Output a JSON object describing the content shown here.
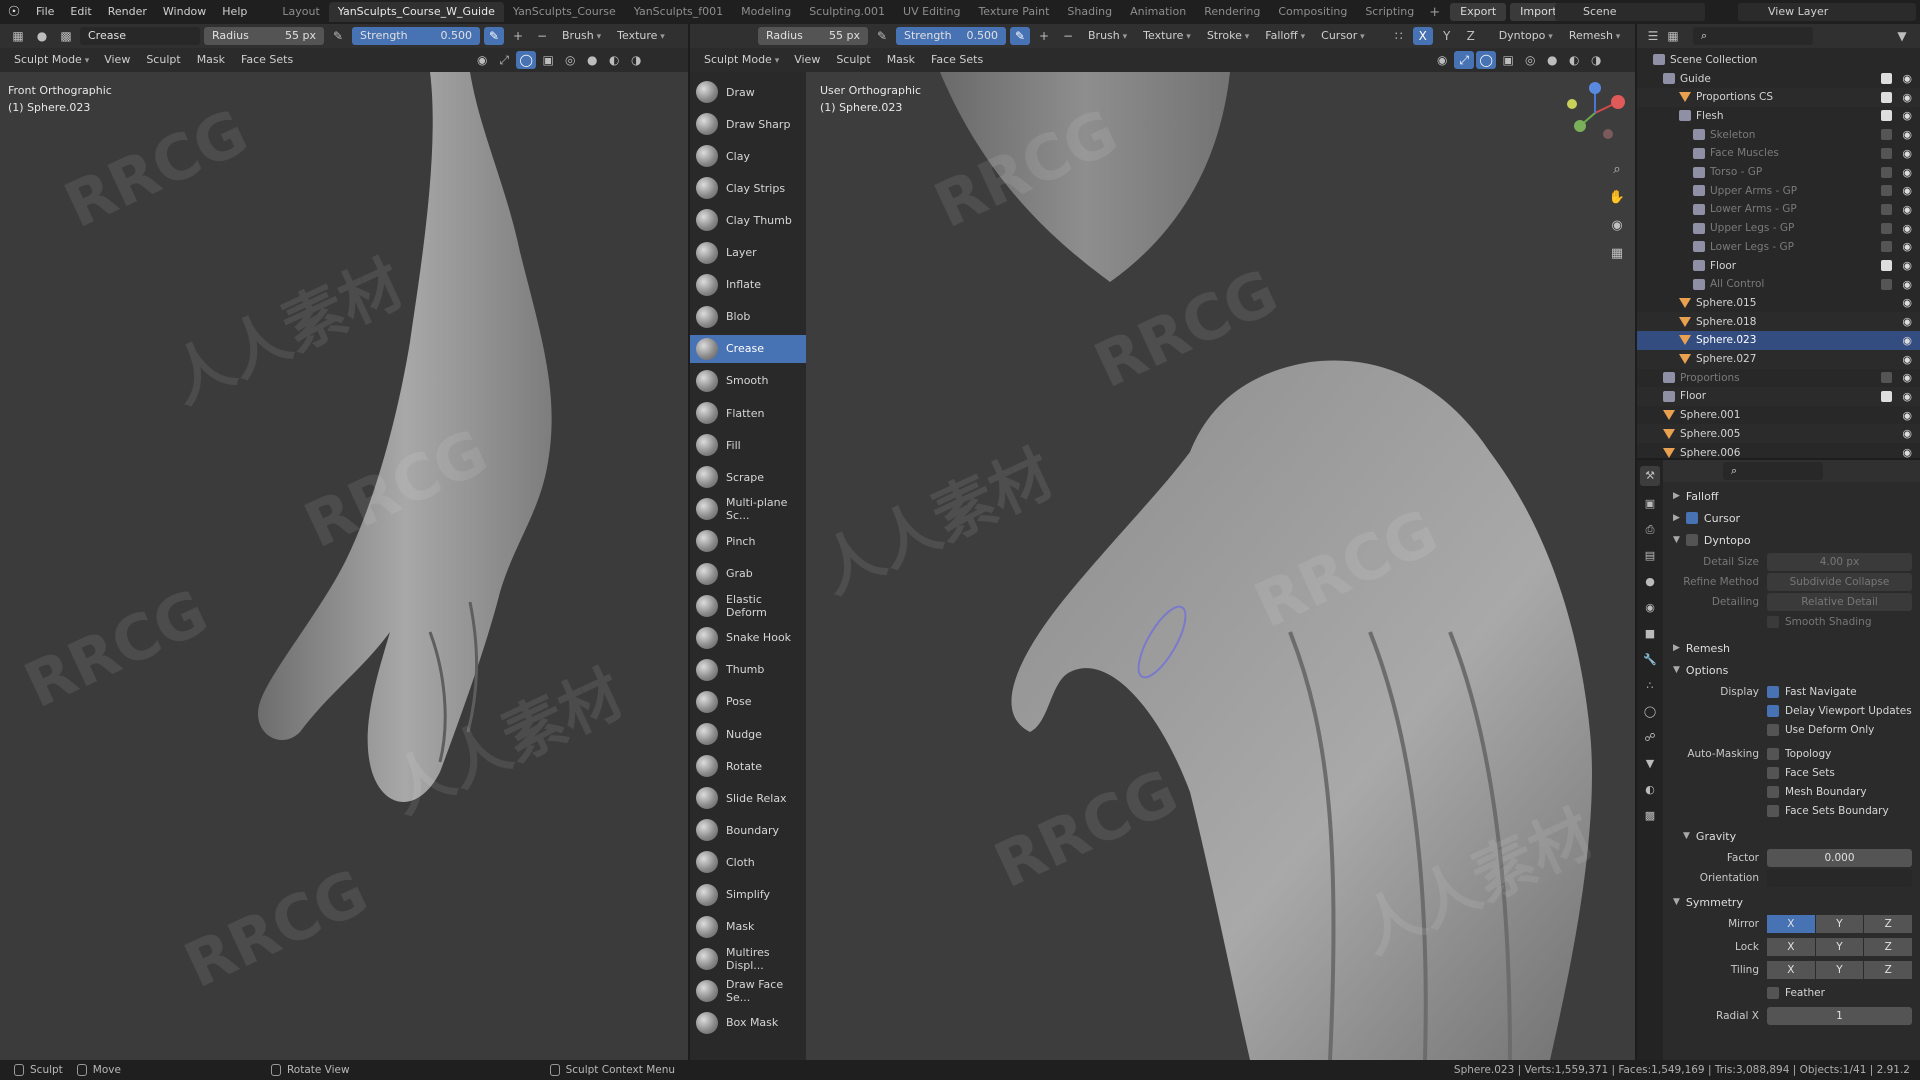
{
  "menubar": {
    "items": [
      "File",
      "Edit",
      "Render",
      "Window",
      "Help"
    ],
    "workspaces": [
      "Layout",
      "YanSculpts_Course_W_Guide",
      "YanSculpts_Course",
      "YanSculpts_f001",
      "Modeling",
      "Sculpting.001",
      "UV Editing",
      "Texture Paint",
      "Shading",
      "Animation",
      "Rendering",
      "Compositing",
      "Scripting"
    ],
    "active_workspace": "YanSculpts_Course_W_Guide",
    "export_label": "Export",
    "import_label": "Import",
    "scene": "Scene",
    "view_layer": "View Layer"
  },
  "left_tool_header": {
    "brush_name": "Crease",
    "radius_label": "Radius",
    "radius_value": "55 px",
    "strength_label": "Strength",
    "strength_value": "0.500",
    "brush_menu": "Brush",
    "texture_menu": "Texture"
  },
  "right_tool_header": {
    "radius_label": "Radius",
    "radius_value": "55 px",
    "strength_label": "Strength",
    "strength_value": "0.500",
    "brush_menu": "Brush",
    "texture_menu": "Texture",
    "stroke_menu": "Stroke",
    "falloff_menu": "Falloff",
    "cursor_menu": "Cursor",
    "dyntopo_menu": "Dyntopo",
    "remesh_menu": "Remesh",
    "axis_x": "X",
    "axis_y": "Y",
    "axis_z": "Z"
  },
  "mode_header": {
    "mode": "Sculpt Mode",
    "menus": [
      "View",
      "Sculpt",
      "Mask",
      "Face Sets"
    ]
  },
  "left_viewport": {
    "view_name": "Front Orthographic",
    "object_name": "(1) Sphere.023"
  },
  "right_viewport": {
    "view_name": "User Orthographic",
    "object_name": "(1) Sphere.023"
  },
  "watermark_text": [
    "RRCG",
    "人人素材"
  ],
  "tools": [
    "Draw",
    "Draw Sharp",
    "Clay",
    "Clay Strips",
    "Clay Thumb",
    "Layer",
    "Inflate",
    "Blob",
    "Crease",
    "Smooth",
    "Flatten",
    "Fill",
    "Scrape",
    "Multi-plane Sc...",
    "Pinch",
    "Grab",
    "Elastic Deform",
    "Snake Hook",
    "Thumb",
    "Pose",
    "Nudge",
    "Rotate",
    "Slide Relax",
    "Boundary",
    "Cloth",
    "Simplify",
    "Mask",
    "Multires Displ...",
    "Draw Face Se...",
    "Box Mask"
  ],
  "active_tool": "Crease",
  "outliner": {
    "root": "Scene Collection",
    "rows": [
      {
        "name": "Guide",
        "type": "collection",
        "dim": false,
        "selected": false,
        "check": true
      },
      {
        "name": "Proportions CS",
        "type": "object",
        "dim": false,
        "selected": false,
        "check": true
      },
      {
        "name": "Flesh",
        "type": "collection",
        "dim": false,
        "selected": false,
        "check": true
      },
      {
        "name": "Skeleton",
        "type": "collection",
        "dim": true,
        "selected": false,
        "check": false
      },
      {
        "name": "Face Muscles",
        "type": "collection",
        "dim": true,
        "selected": false,
        "check": false
      },
      {
        "name": "Torso - GP",
        "type": "collection",
        "dim": true,
        "selected": false,
        "check": false
      },
      {
        "name": "Upper Arms - GP",
        "type": "collection",
        "dim": true,
        "selected": false,
        "check": false
      },
      {
        "name": "Lower Arms - GP",
        "type": "collection",
        "dim": true,
        "selected": false,
        "check": false
      },
      {
        "name": "Upper Legs - GP",
        "type": "collection",
        "dim": true,
        "selected": false,
        "check": false
      },
      {
        "name": "Lower Legs - GP",
        "type": "collection",
        "dim": true,
        "selected": false,
        "check": false
      },
      {
        "name": "Floor",
        "type": "collection",
        "dim": false,
        "selected": false,
        "check": true
      },
      {
        "name": "All Control",
        "type": "collection",
        "dim": true,
        "selected": false,
        "check": false
      },
      {
        "name": "Sphere.015",
        "type": "object",
        "dim": false,
        "selected": false,
        "check": null
      },
      {
        "name": "Sphere.018",
        "type": "object",
        "dim": false,
        "selected": false,
        "check": null
      },
      {
        "name": "Sphere.023",
        "type": "object",
        "dim": false,
        "selected": true,
        "check": null
      },
      {
        "name": "Sphere.027",
        "type": "object",
        "dim": false,
        "selected": false,
        "check": null
      },
      {
        "name": "Proportions",
        "type": "collection",
        "dim": true,
        "selected": false,
        "check": false
      },
      {
        "name": "Floor",
        "type": "collection",
        "dim": false,
        "selected": false,
        "check": true
      },
      {
        "name": "Sphere.001",
        "type": "object",
        "dim": false,
        "selected": false,
        "check": null
      },
      {
        "name": "Sphere.005",
        "type": "object",
        "dim": false,
        "selected": false,
        "check": null
      },
      {
        "name": "Sphere.006",
        "type": "object",
        "dim": false,
        "selected": false,
        "check": null
      }
    ]
  },
  "properties": {
    "falloff": "Falloff",
    "cursor": "Cursor",
    "dyntopo": "Dyntopo",
    "detail_size_label": "Detail Size",
    "detail_size_value": "4.00 px",
    "refine_method_label": "Refine Method",
    "refine_method_value": "Subdivide Collapse",
    "detailing_label": "Detailing",
    "detailing_value": "Relative Detail",
    "smooth_shading": "Smooth Shading",
    "remesh": "Remesh",
    "options": "Options",
    "display_label": "Display",
    "fast_navigate": "Fast Navigate",
    "delay_viewport_updates": "Delay Viewport Updates",
    "use_deform_only": "Use Deform Only",
    "auto_masking_label": "Auto-Masking",
    "topology": "Topology",
    "face_sets": "Face Sets",
    "mesh_boundary": "Mesh Boundary",
    "face_sets_boundary": "Face Sets Boundary",
    "gravity": "Gravity",
    "factor_label": "Factor",
    "factor_value": "0.000",
    "orientation_label": "Orientation",
    "symmetry": "Symmetry",
    "mirror_label": "Mirror",
    "lock_label": "Lock",
    "tiling_label": "Tiling",
    "feather": "Feather",
    "radial_label": "Radial X",
    "radial_value": "1",
    "x": "X",
    "y": "Y",
    "z": "Z"
  },
  "statusbar": {
    "sculpt": "Sculpt",
    "move": "Move",
    "rotate_view": "Rotate View",
    "context_menu": "Sculpt Context Menu",
    "stats": "Sphere.023 | Verts:1,559,371 | Faces:1,549,169 | Tris:3,088,894 | Objects:1/41 | 2.91.2"
  }
}
